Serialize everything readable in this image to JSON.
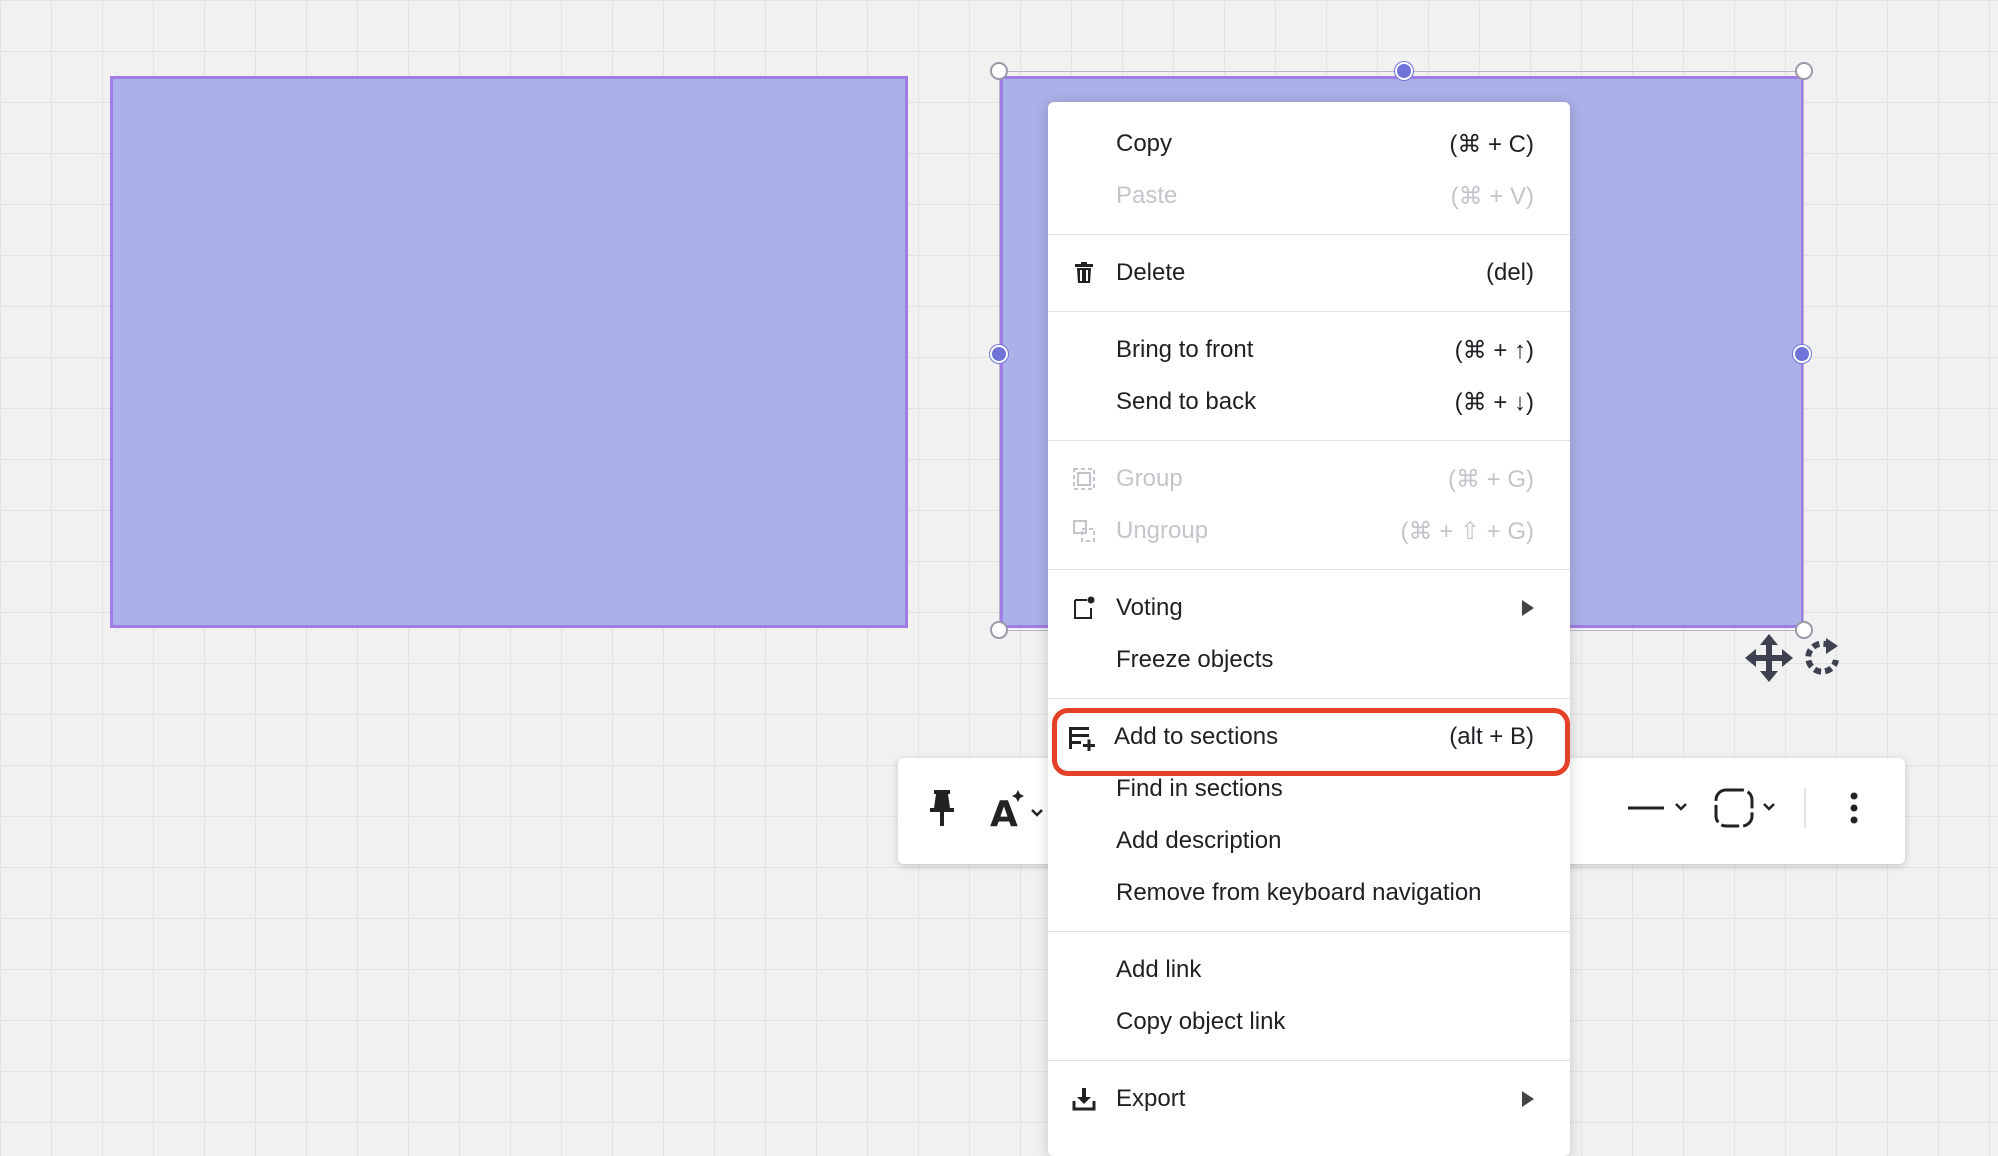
{
  "colors": {
    "shape_fill": "#aab0e8",
    "shape_border": "#a07de6",
    "selection_handle": "#6f73d8",
    "highlight": "#e54028"
  },
  "toolbar": {
    "icons": [
      "pin-icon",
      "text-style-icon",
      "line-style-icon",
      "shape-border-icon",
      "more-icon"
    ]
  },
  "menu": {
    "copy": {
      "label": "Copy",
      "shortcut": "(⌘ + C)"
    },
    "paste": {
      "label": "Paste",
      "shortcut": "(⌘ + V)"
    },
    "delete": {
      "label": "Delete",
      "shortcut": "(del)"
    },
    "bring_front": {
      "label": "Bring to front",
      "shortcut": "(⌘ + ↑)"
    },
    "send_back": {
      "label": "Send to back",
      "shortcut": "(⌘ + ↓)"
    },
    "group": {
      "label": "Group",
      "shortcut": "(⌘ + G)"
    },
    "ungroup": {
      "label": "Ungroup",
      "shortcut": "(⌘ + ⇧ + G)"
    },
    "voting": {
      "label": "Voting"
    },
    "freeze": {
      "label": "Freeze objects"
    },
    "add_sections": {
      "label": "Add to sections",
      "shortcut": "(alt + B)"
    },
    "find_sections": {
      "label": "Find in sections"
    },
    "add_description": {
      "label": "Add description"
    },
    "remove_nav": {
      "label": "Remove from keyboard navigation"
    },
    "add_link": {
      "label": "Add link"
    },
    "copy_link": {
      "label": "Copy object link"
    },
    "export": {
      "label": "Export"
    }
  }
}
